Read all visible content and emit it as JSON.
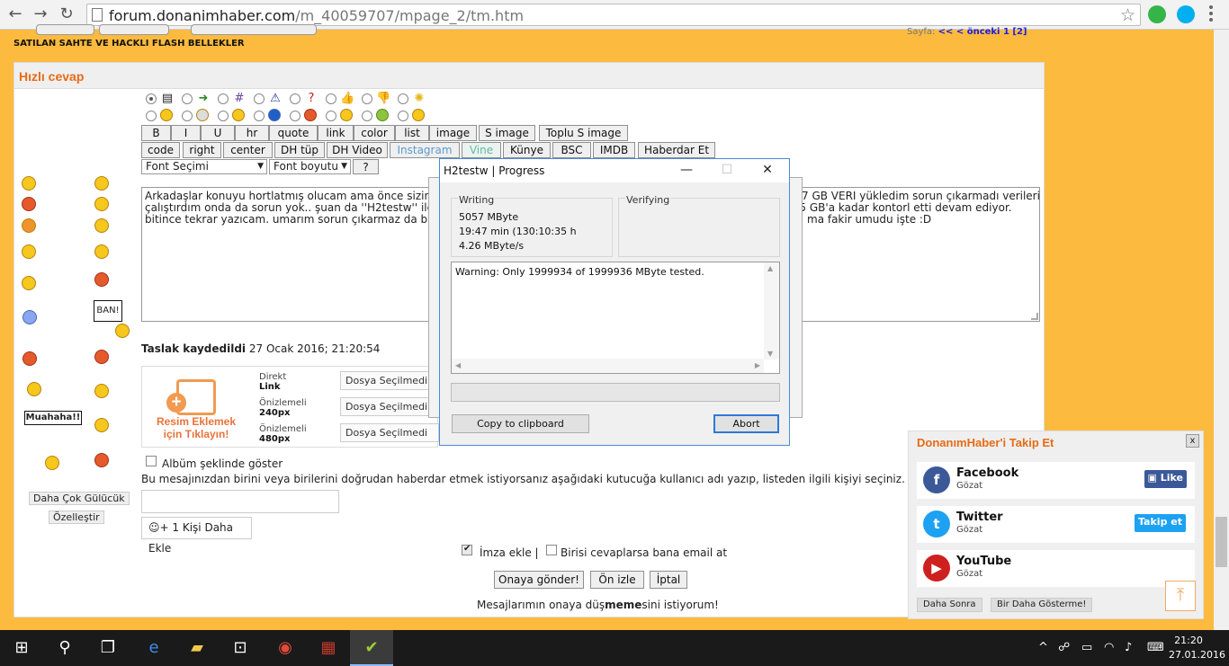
{
  "browser": {
    "url_host": "forum.donanimhaber.com",
    "url_path": "/m_40059707/mpage_2/tm.htm",
    "icons": [
      "back-icon",
      "forward-icon",
      "reload-icon",
      "star-icon",
      "menu-icon"
    ]
  },
  "page": {
    "news_link": "SATILAN SAHTE VE HACKLI FLASH BELLEKLER",
    "pager_prefix": "Sayfa:",
    "pager_links": "<<  < önceki  1 [2]",
    "panel_title": "Hızlı cevap",
    "bbcode_row1": [
      "B",
      "I",
      "U",
      "hr",
      "quote",
      "link",
      "color",
      "list",
      "image",
      "S image",
      "Toplu S image"
    ],
    "bbcode_row2": [
      "code",
      "right",
      "center",
      "DH tüp",
      "DH Video",
      "Instagram",
      "Vine",
      "Künye",
      "BSC",
      "IMDB",
      "Haberdar Et"
    ],
    "font_select": "Font Seçimi",
    "size_select": "Font boyutu",
    "help_btn": "?",
    "ban_text": "BAN!",
    "muahaha_text": "Muahaha!!",
    "more_smileys": "Daha Çok Gülücük",
    "customize": "Özelleştir",
    "editor_lines": [
      "Arkadaşlar konuyu hortlatmış olucam ama önce sizin iç",
      "çalıştırdım onda da sorun yok.. şuan da ''H2testw'' ile te",
      "bitince tekrar yazıcam. umarım sorun çıkarmaz da bu u"
    ],
    "editor_lines_right": [
      "7 GB VERİ  yükledim sorun çıkarmadı verileri",
      "n 5 GB'a kadar kontorl etti devam ediyor.",
      "ma fakir umudu işte :D"
    ],
    "draft_label": "Taslak kaydedildi",
    "draft_time": "27 Ocak 2016; 21:20:54",
    "upload_text": "Resim Eklemek için Tıklayın!",
    "upload_rows": [
      {
        "l1": "Direkt",
        "l2": "Link",
        "file": "Dosya Seçilmedi"
      },
      {
        "l1": "Önizlemeli",
        "l2": "240px",
        "file": "Dosya Seçilmedi"
      },
      {
        "l1": "Önizlemeli",
        "l2": "480px",
        "file": "Dosya Seçilmedi"
      }
    ],
    "album_label": "Albüm şeklinde göster",
    "mention_text": "Bu mesajınızdan birini veya birilerini doğrudan haberdar etmek istiyorsanız aşağıdaki kutucuğa kullanıcı adı yazıp, listeden ilgili kişiyi seçiniz.",
    "add_person": "1 Kişi Daha Ekle",
    "signature_label": "İmza ekle |",
    "notify_label": "Birisi cevaplarsa bana email at",
    "buttons": [
      "Onaya gönder!",
      "Ön izle",
      "İptal"
    ],
    "footer_pre": "Mesajlarımın onaya düş",
    "footer_bold": "meme",
    "footer_post": "sini istiyorum!"
  },
  "dialog": {
    "title": "H2testw | Progress",
    "writing_label": "Writing",
    "verifying_label": "Verifying",
    "written": "5057 MByte",
    "elapsed": "19:47 min (130:10:35 h",
    "speed": "4.26 MByte/s",
    "log": "Warning: Only 1999934 of 1999936 MByte tested.",
    "progress_percent": 0,
    "copy_btn": "Copy to clipboard",
    "abort_btn": "Abort"
  },
  "follow": {
    "title": "DonanımHaber'i Takip Et",
    "close": "x",
    "items": [
      {
        "name": "Facebook",
        "sub": "Gözat",
        "btn": "Like",
        "color": "#3b5998"
      },
      {
        "name": "Twitter",
        "sub": "Gözat",
        "btn": "Takip et",
        "color": "#1da1f2"
      },
      {
        "name": "YouTube",
        "sub": "Gözat",
        "btn": "",
        "color": "#cd201f"
      }
    ],
    "later": "Daha Sonra",
    "never": "Bir Daha Gösterme!"
  },
  "taskbar": {
    "time": "21:20",
    "date": "27.01.2016"
  }
}
